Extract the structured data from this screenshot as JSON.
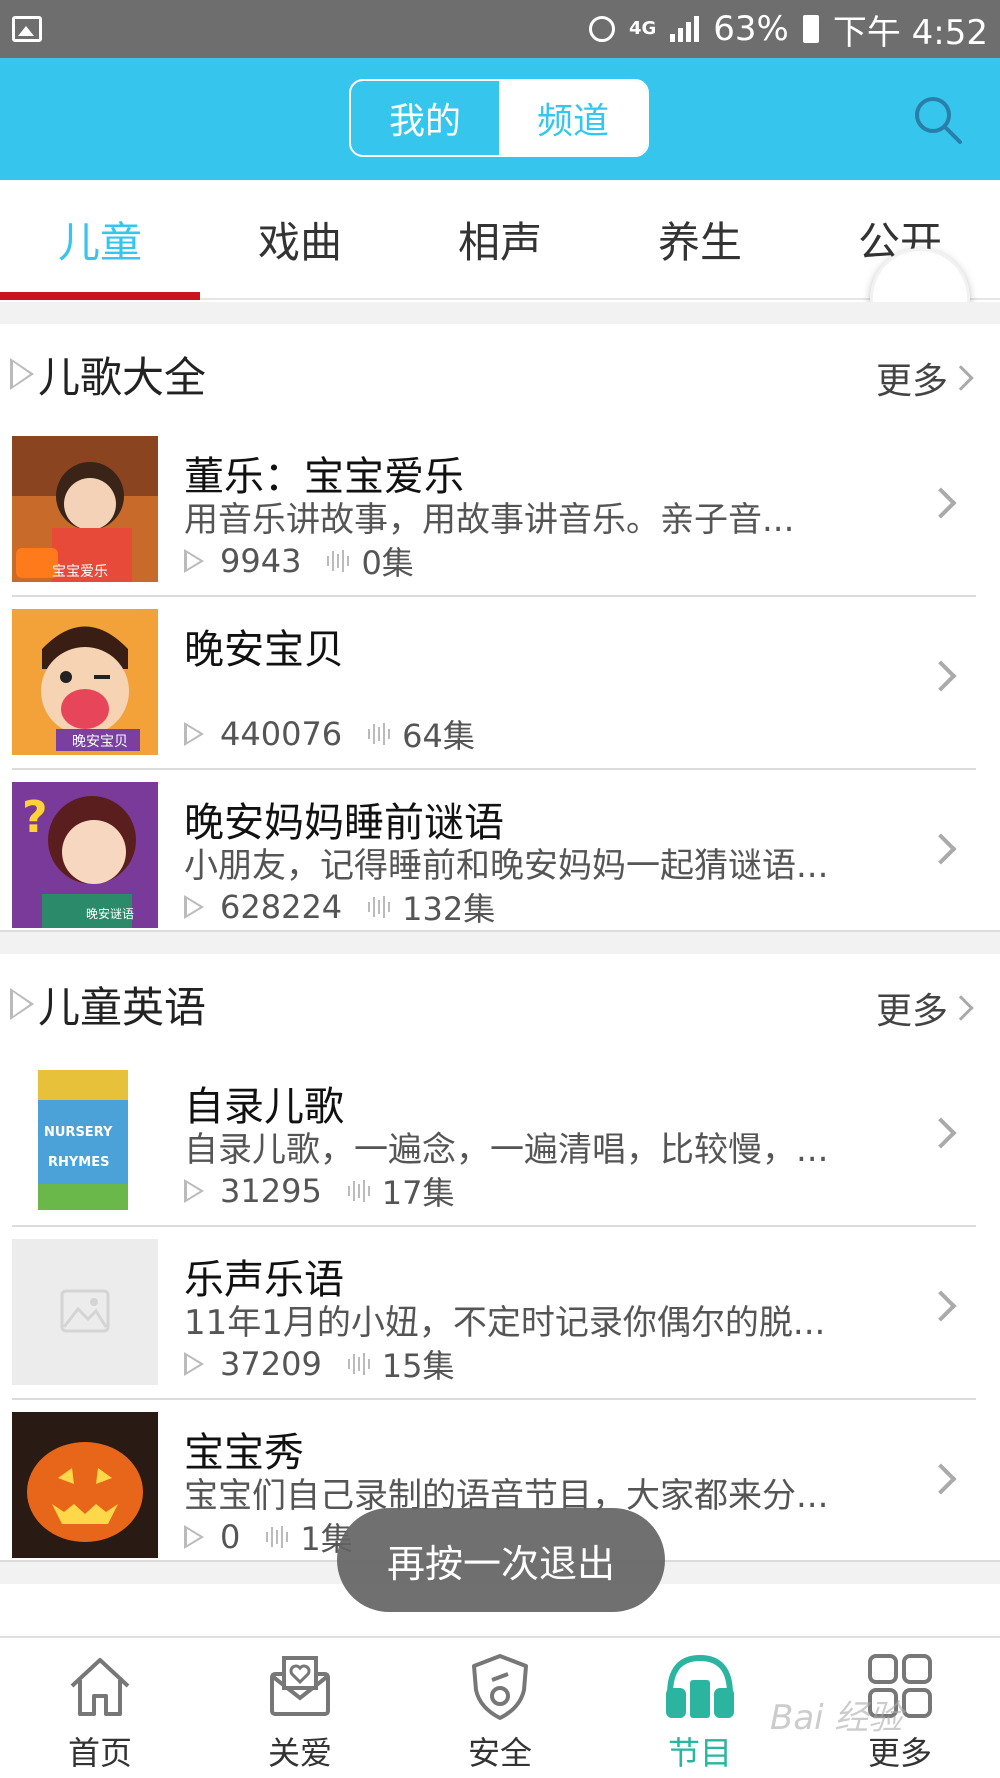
{
  "status_bar": {
    "network": "4G",
    "battery": "63%",
    "time": "下午 4:52"
  },
  "header": {
    "segment": [
      "我的",
      "频道"
    ],
    "selected_segment": "频道"
  },
  "tabs": [
    "儿童",
    "戏曲",
    "相声",
    "养生",
    "公开"
  ],
  "active_tab": "儿童",
  "sections": [
    {
      "title": "儿歌大全",
      "more": "更多",
      "items": [
        {
          "title": "董乐：宝宝爱乐",
          "desc": "用音乐讲故事，用故事讲音乐。亲子音...",
          "plays": "9943",
          "episodes": "0集",
          "thumb_text": "宝宝爱乐"
        },
        {
          "title": "晚安宝贝",
          "desc": "",
          "plays": "440076",
          "episodes": "64集",
          "thumb_text": "晚安宝贝"
        },
        {
          "title": "晚安妈妈睡前谜语",
          "desc": "小朋友，记得睡前和晚安妈妈一起猜谜语...",
          "plays": "628224",
          "episodes": "132集",
          "thumb_text": "晚安谜语"
        }
      ]
    },
    {
      "title": "儿童英语",
      "more": "更多",
      "items": [
        {
          "title": "自录儿歌",
          "desc": "自录儿歌，一遍念，一遍清唱，比较慢，...",
          "plays": "31295",
          "episodes": "17集",
          "thumb_text": "NURSERY RHYMES"
        },
        {
          "title": "乐声乐语",
          "desc": "11年1月的小妞，不定时记录你偶尔的脱...",
          "plays": "37209",
          "episodes": "15集",
          "thumb_text": ""
        },
        {
          "title": "宝宝秀",
          "desc": "宝宝们自己录制的语音节目，大家都来分...",
          "plays": "0",
          "episodes": "1集",
          "thumb_text": ""
        }
      ]
    }
  ],
  "toast": "再按一次退出",
  "bottom_nav": [
    {
      "label": "首页",
      "icon": "home-icon"
    },
    {
      "label": "关爱",
      "icon": "care-mail-icon"
    },
    {
      "label": "安全",
      "icon": "shield-icon"
    },
    {
      "label": "节目",
      "icon": "headphones-icon"
    },
    {
      "label": "更多",
      "icon": "grid-icon"
    }
  ],
  "active_nav": "节目",
  "watermark": "Bai 经验",
  "colors": {
    "accent": "#36c5ec",
    "tab_indicator": "#c8141e",
    "nav_active": "#2bb5a0"
  }
}
